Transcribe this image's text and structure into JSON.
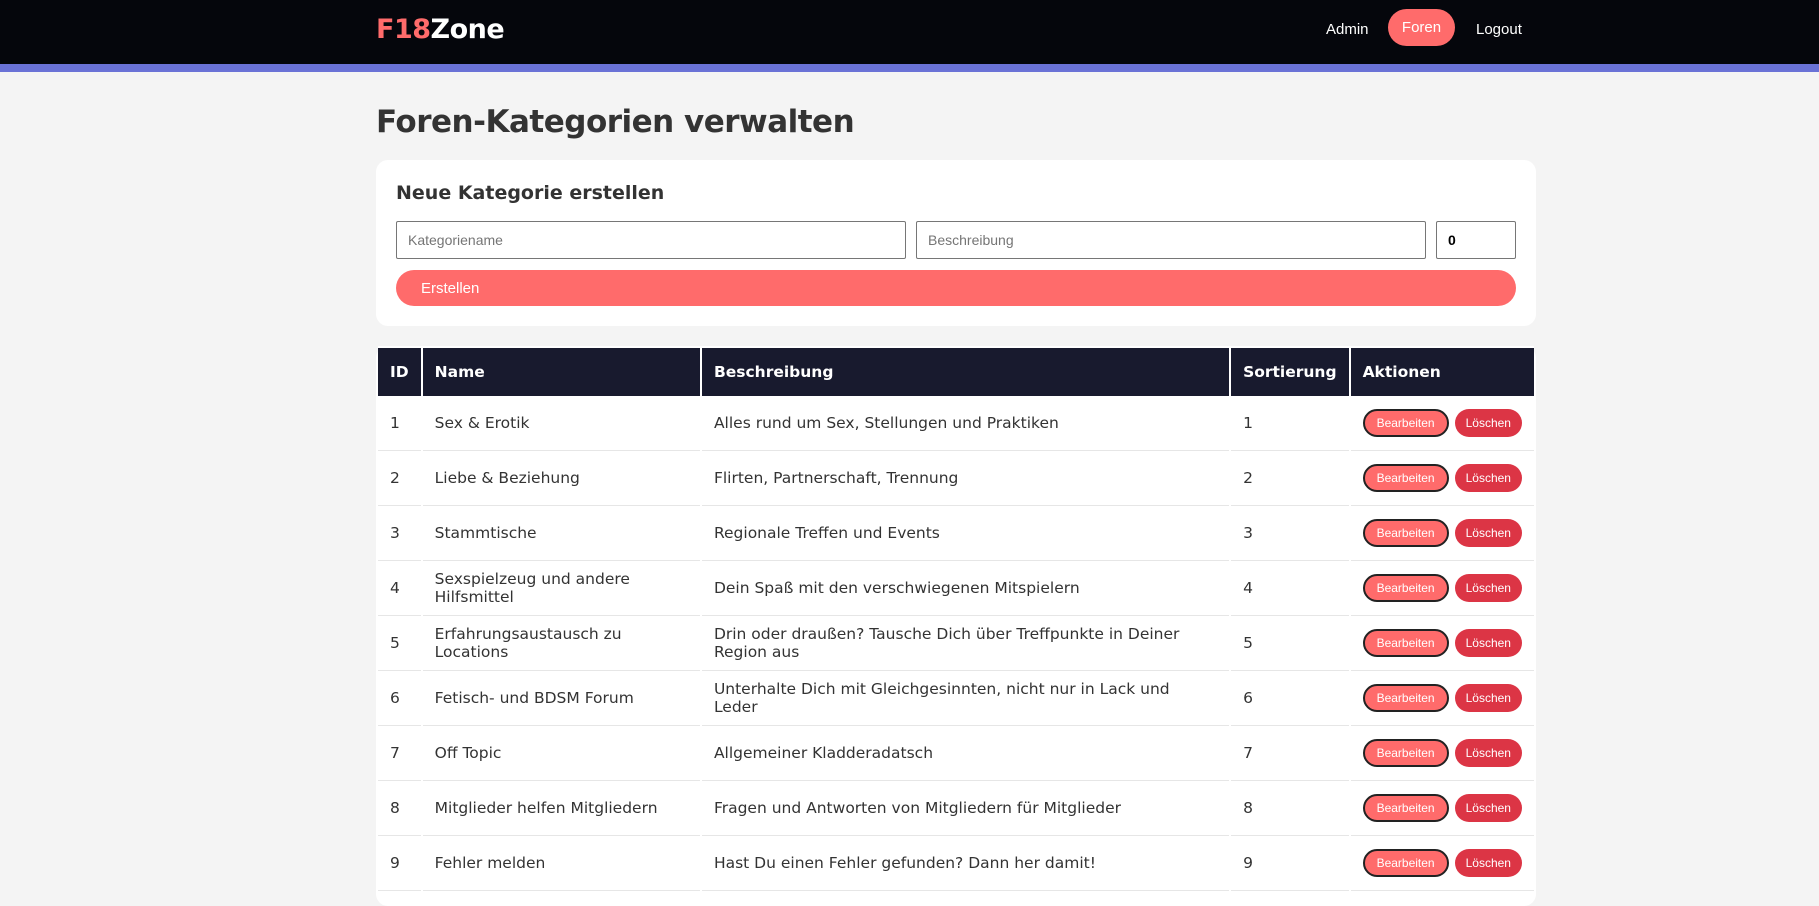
{
  "header": {
    "logo_part1": "F18",
    "logo_part2": "Zone",
    "nav": {
      "admin": "Admin",
      "foren": "Foren",
      "logout": "Logout"
    }
  },
  "page": {
    "title": "Foren-Kategorien verwalten"
  },
  "form": {
    "title": "Neue Kategorie erstellen",
    "name_placeholder": "Kategoriename",
    "desc_placeholder": "Beschreibung",
    "sort_value": "0",
    "submit_label": "Erstellen"
  },
  "table": {
    "headers": {
      "id": "ID",
      "name": "Name",
      "desc": "Beschreibung",
      "sort": "Sortierung",
      "actions": "Aktionen"
    },
    "edit_label": "Bearbeiten",
    "delete_label": "Löschen",
    "rows": [
      {
        "id": "1",
        "name": "Sex & Erotik",
        "desc": "Alles rund um Sex, Stellungen und Praktiken",
        "sort": "1"
      },
      {
        "id": "2",
        "name": "Liebe & Beziehung",
        "desc": "Flirten, Partnerschaft, Trennung",
        "sort": "2"
      },
      {
        "id": "3",
        "name": "Stammtische",
        "desc": "Regionale Treffen und Events",
        "sort": "3"
      },
      {
        "id": "4",
        "name": "Sexspielzeug und andere Hilfsmittel",
        "desc": "Dein Spaß mit den verschwiegenen Mitspielern",
        "sort": "4"
      },
      {
        "id": "5",
        "name": "Erfahrungsaustausch zu Locations",
        "desc": "Drin oder draußen? Tausche Dich über Treffpunkte in Deiner Region aus",
        "sort": "5"
      },
      {
        "id": "6",
        "name": "Fetisch- und BDSM Forum",
        "desc": "Unterhalte Dich mit Gleichgesinnten, nicht nur in Lack und Leder",
        "sort": "6"
      },
      {
        "id": "7",
        "name": "Off Topic",
        "desc": "Allgemeiner Kladderadatsch",
        "sort": "7"
      },
      {
        "id": "8",
        "name": "Mitglieder helfen Mitgliedern",
        "desc": "Fragen und Antworten von Mitgliedern für Mitglieder",
        "sort": "8"
      },
      {
        "id": "9",
        "name": "Fehler melden",
        "desc": "Hast Du einen Fehler gefunden? Dann her damit!",
        "sort": "9"
      }
    ]
  },
  "colors": {
    "accent": "#ff6b6b",
    "danger": "#dc3545",
    "header_bg": "#05060c",
    "table_head_bg": "#181a2e",
    "header_border": "#6a72d6"
  }
}
